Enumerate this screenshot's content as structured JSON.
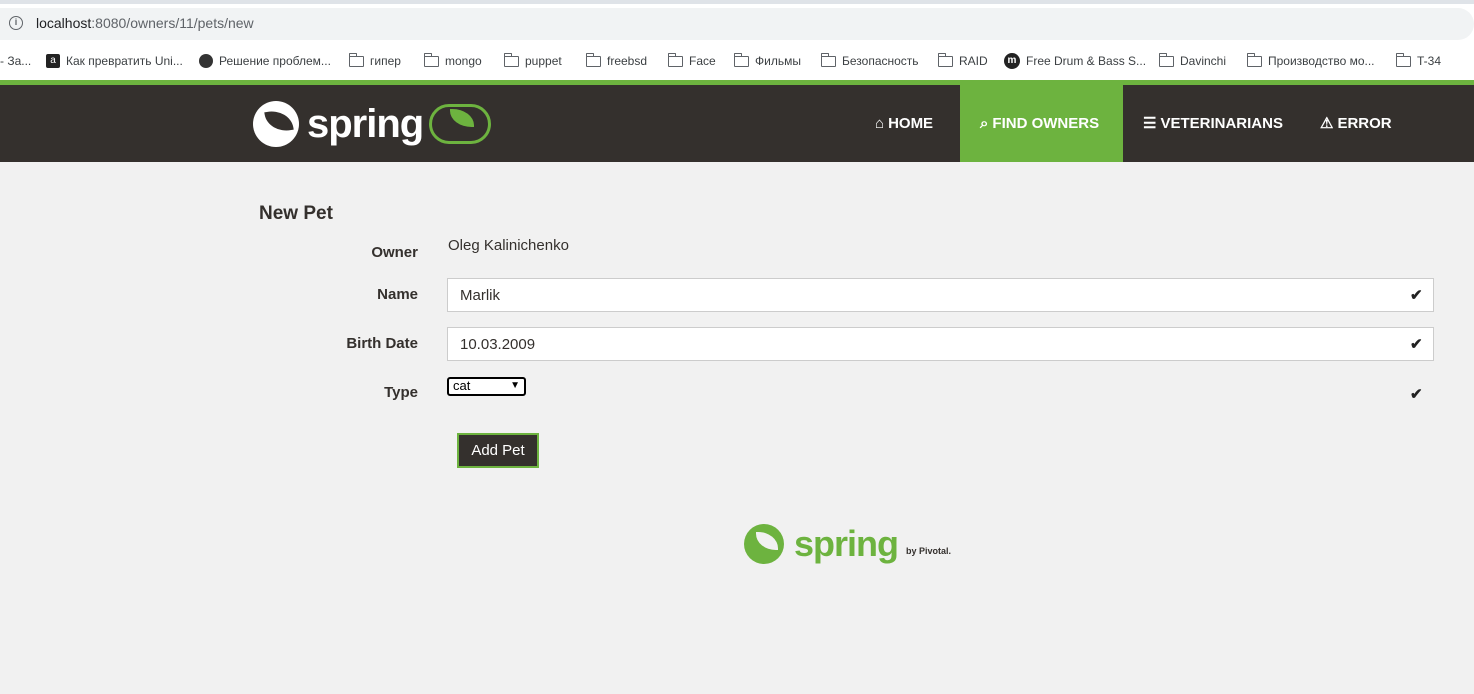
{
  "browser": {
    "url_host": "localhost",
    "url_rest": ":8080/owners/11/pets/new"
  },
  "bookmarks": [
    {
      "label": "- За...",
      "icon": "none"
    },
    {
      "label": "Как превратить Uni...",
      "icon": "a-icon"
    },
    {
      "label": "Решение проблем...",
      "icon": "globe-icon"
    },
    {
      "label": "гипер",
      "icon": "folder-icon"
    },
    {
      "label": "mongo",
      "icon": "folder-icon"
    },
    {
      "label": "puppet",
      "icon": "folder-icon"
    },
    {
      "label": "freebsd",
      "icon": "folder-icon"
    },
    {
      "label": "Face",
      "icon": "folder-icon"
    },
    {
      "label": "Фильмы",
      "icon": "folder-icon"
    },
    {
      "label": "Безопасность",
      "icon": "folder-icon"
    },
    {
      "label": "RAID",
      "icon": "folder-icon"
    },
    {
      "label": "Free Drum & Bass S...",
      "icon": "m-icon"
    },
    {
      "label": "Davinchi",
      "icon": "folder-icon"
    },
    {
      "label": "Производство мо...",
      "icon": "folder-icon"
    },
    {
      "label": "T-34",
      "icon": "folder-icon"
    }
  ],
  "nav": {
    "brand": "spring",
    "items": [
      {
        "label": "HOME",
        "icon": "home-icon"
      },
      {
        "label": "FIND OWNERS",
        "icon": "search-icon"
      },
      {
        "label": "VETERINARIANS",
        "icon": "list-icon"
      },
      {
        "label": "ERROR",
        "icon": "warning-icon"
      }
    ]
  },
  "form": {
    "heading": "New Pet",
    "owner_label": "Owner",
    "owner_value": "Oleg Kalinichenko",
    "name_label": "Name",
    "name_value": "Marlik",
    "birth_label": "Birth Date",
    "birth_value": "10.03.2009",
    "type_label": "Type",
    "type_value": "cat",
    "submit_label": "Add Pet"
  },
  "footer": {
    "brand": "spring",
    "by": "by Pivotal."
  },
  "colors": {
    "accent": "#6db33f",
    "dark": "#34302d",
    "background": "#f1f1f1"
  }
}
